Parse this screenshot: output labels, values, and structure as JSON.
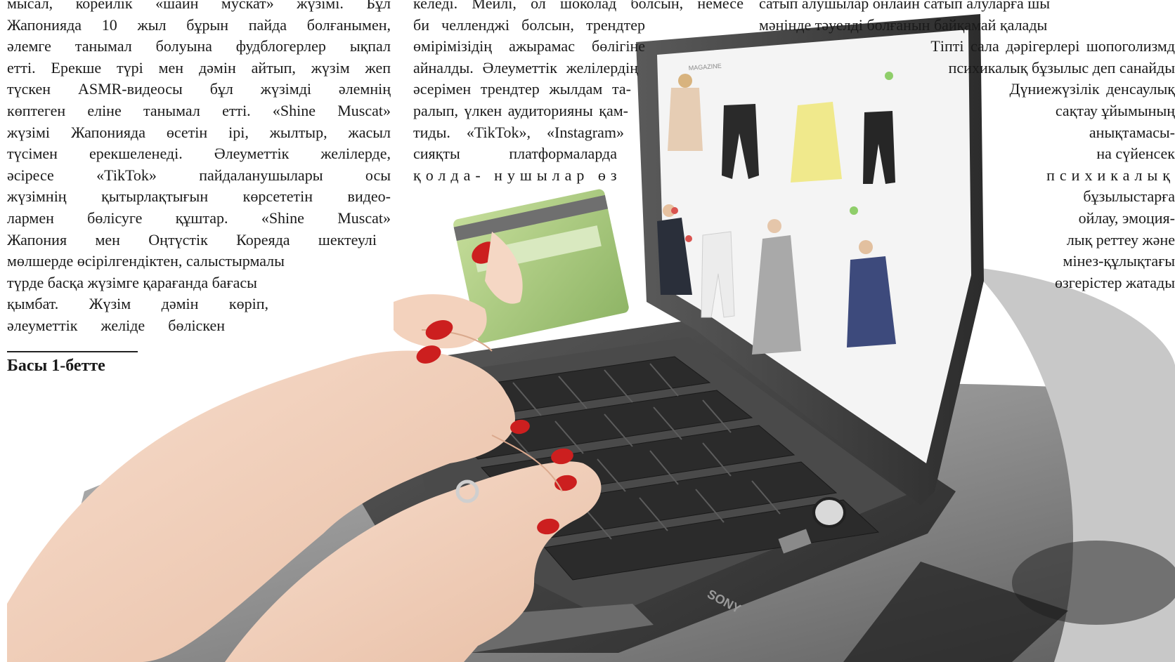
{
  "article": {
    "col_left": [
      "мысал, корейлік «шайн мускат» жүзімі. Бұл",
      "Жапонияда 10 жыл бұрын пайда болғанымен,",
      "әлемге танымал болуына фудблогерлер ықпал",
      "етті. Ерекше түрі мен дәмін айтып, жүзім жеп",
      "түскен ASMR-видеосы бұл жүзімді әлемнің",
      "көптеген еліне танымал етті. «Shine Muscat»",
      "жүзімі Жапонияда өсетін ірі, жылтыр, жасыл",
      "түсімен ерекшеленеді. Әлеуметтік желілерде,",
      "әсіресе «TikTok» пайдаланушылары осы",
      "жүзімнің қытырлақтығын көрсететін видео-",
      "лармен бөлісуге құштар. «Shine Muscat»",
      "Жапония мен Оңтүстік Кореяда шектеулі",
      "мөлшерде өсірілгендіктен, салыстырмалы",
      "түрде басқа жүзімге қарағанда бағасы",
      "қымбат. Жүзім дәмін көріп,",
      "әлеуметтік желіде бөліскен"
    ],
    "continued": "Басы 1-бетте",
    "col_mid": [
      "келеді. Мейлі, ол шоколад болсын, немесе",
      "би челленджі болсын, трендтер",
      "өмірімізідің ажырамас бөлігіне",
      "айналды. Әлеуметтік желілердің",
      "әсерімен трендтер жылдам та-",
      "ралып, үлкен аудиторияны қам-",
      "тиды. «TikTok», «Instagram»",
      "сияқты платформаларда",
      "қолда- нушылар өз"
    ],
    "col_right": [
      "сатып алушылар онлайн сатып алуларға шы",
      "мәнінде тәуелді болғанын байқамай қалады",
      "Тіпті сала дәрігерлері шопоголизмд",
      "психикалық бұзылыс деп санайды",
      "Дүниежүзілік денсаулық",
      "сақтау ұйымының",
      "анықтамасы-",
      "на сүйенсек",
      "психикалық",
      "бұзылыстарға",
      "ойлау, эмоция-",
      "лық реттеу және",
      "мінез-құлықтағы",
      "өзгерістер жатады"
    ]
  },
  "photo": {
    "description_icon": "online-shopping-photo",
    "laptop_brand": "SONY",
    "screen_logo": "MAGAZINE"
  }
}
